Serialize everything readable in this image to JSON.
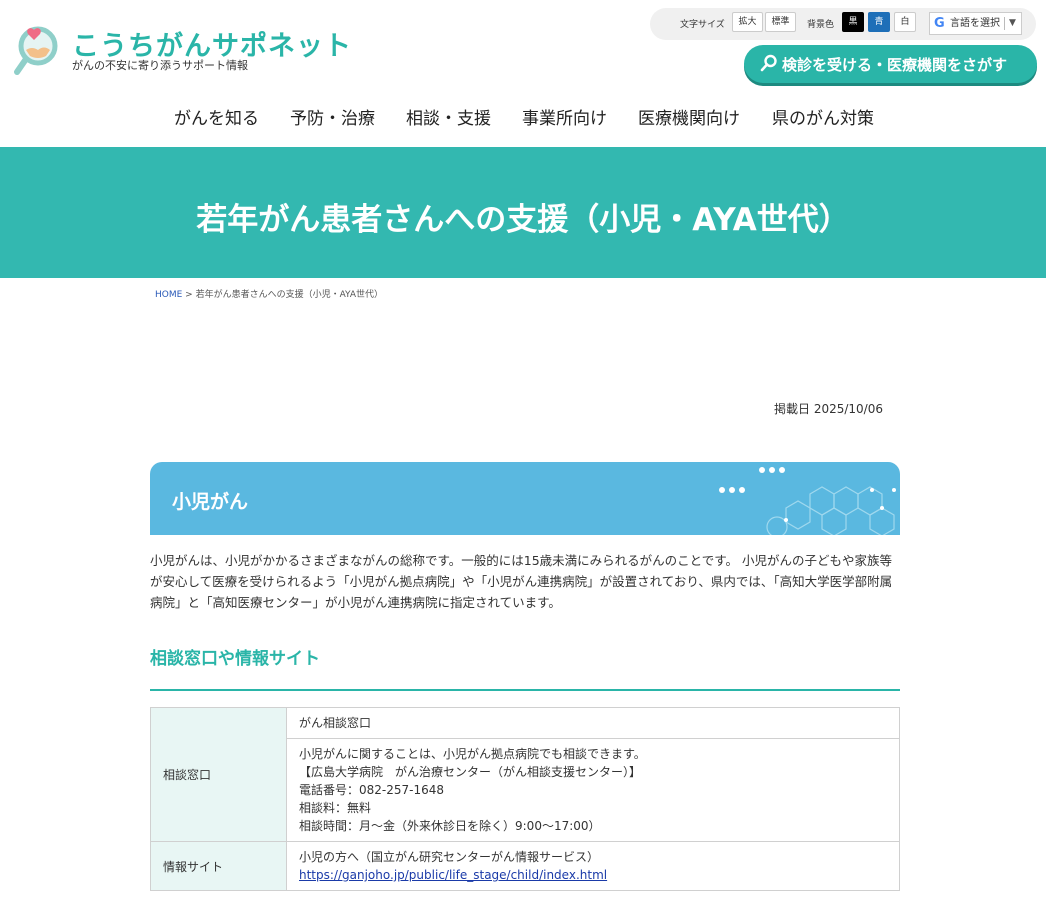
{
  "header": {
    "site_title": "こうちがんサポネット",
    "site_subtitle": "がんの不安に寄り添うサポート情報",
    "font_size_label": "文字サイズ",
    "font_size_large": "拡大",
    "font_size_normal": "標準",
    "bg_color_label": "背景色",
    "bg_black": "黒",
    "bg_blue": "青",
    "bg_white": "白",
    "language_label": "言語を選択",
    "search_button": "検診を受ける・医療機関をさがす"
  },
  "nav": {
    "items": [
      "がんを知る",
      "予防・治療",
      "相談・支援",
      "事業所向け",
      "医療機関向け",
      "県のがん対策"
    ]
  },
  "page": {
    "title": "若年がん患者さんへの支援（小児・AYA世代）",
    "breadcrumb_home": "HOME",
    "breadcrumb_sep": " > ",
    "breadcrumb_current": "若年がん患者さんへの支援（小児・AYA世代）",
    "published": "掲載日 2025/10/06"
  },
  "section": {
    "heading": "小児がん",
    "intro": "小児がんは、小児がかかるさまざまながんの総称です。一般的には15歳未満にみられるがんのことです。 小児がんの子どもや家族等が安心して医療を受けられるよう「小児がん拠点病院」や「小児がん連携病院」が設置されており、県内では、「高知大学医学部附属病院」と「高知医療センター」が小児がん連携病院に指定されています。",
    "subheading": "相談窓口や情報サイト"
  },
  "table": {
    "rows": [
      {
        "header": "相談窓口",
        "cells": [
          [
            "がん相談窓口"
          ],
          [
            "小児がんに関することは、小児がん拠点病院でも相談できます。",
            "【広島大学病院　がん治療センター（がん相談支援センター）】",
            "電話番号：082-257-1648",
            "相談料：無料",
            "相談時間：月～金（外来休診日を除く）9:00～17:00）"
          ]
        ]
      },
      {
        "header": "情報サイト",
        "text": "小児の方へ（国立がん研究センターがん情報サービス）",
        "link": "https://ganjoho.jp/public/life_stage/child/index.html"
      }
    ]
  },
  "colors": {
    "brand": "#2ab5a8",
    "hero": "#33b8b0",
    "banner": "#5ab8e0",
    "table_header_bg": "#e8f6f4"
  }
}
